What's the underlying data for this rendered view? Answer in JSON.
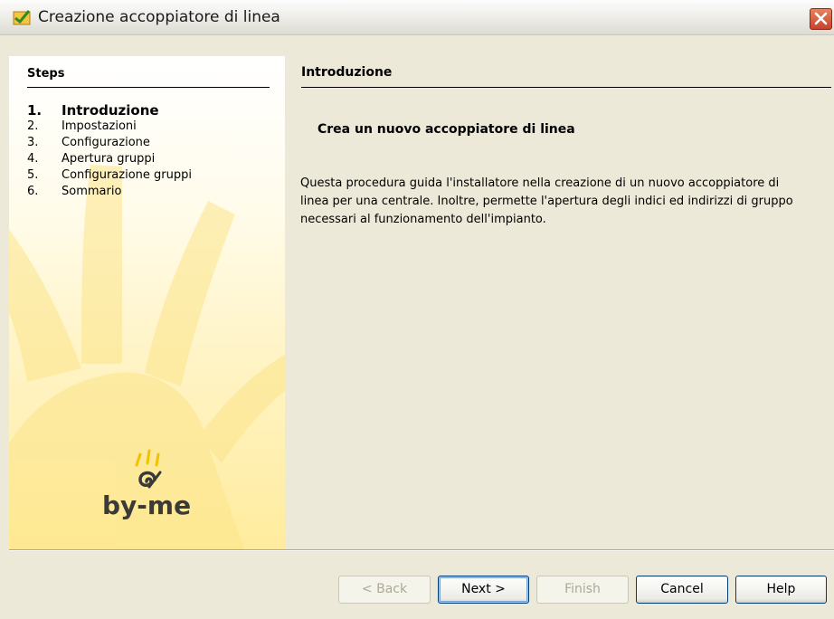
{
  "window": {
    "title": "Creazione accoppiatore di linea"
  },
  "steps": {
    "heading": "Steps",
    "items": [
      {
        "num": "1.",
        "label": "Introduzione"
      },
      {
        "num": "2.",
        "label": "Impostazioni"
      },
      {
        "num": "3.",
        "label": "Configurazione"
      },
      {
        "num": "4.",
        "label": "Apertura gruppi"
      },
      {
        "num": "5.",
        "label": "Configurazione gruppi"
      },
      {
        "num": "6.",
        "label": "Sommario"
      }
    ]
  },
  "logo": {
    "text": "by-me"
  },
  "content": {
    "heading": "Introduzione",
    "subtitle": "Crea un nuovo accoppiatore di linea",
    "description": "Questa procedura guida l'installatore nella creazione di un nuovo accoppiatore di linea per una centrale. Inoltre, permette l'apertura degli indici ed indirizzi di gruppo necessari al funzionamento dell'impianto."
  },
  "buttons": {
    "back": "< Back",
    "next": "Next >",
    "finish": "Finish",
    "cancel": "Cancel",
    "help": "Help"
  },
  "colors": {
    "accent_yellow": "#ffec9e",
    "close_red": "#c8412b"
  }
}
